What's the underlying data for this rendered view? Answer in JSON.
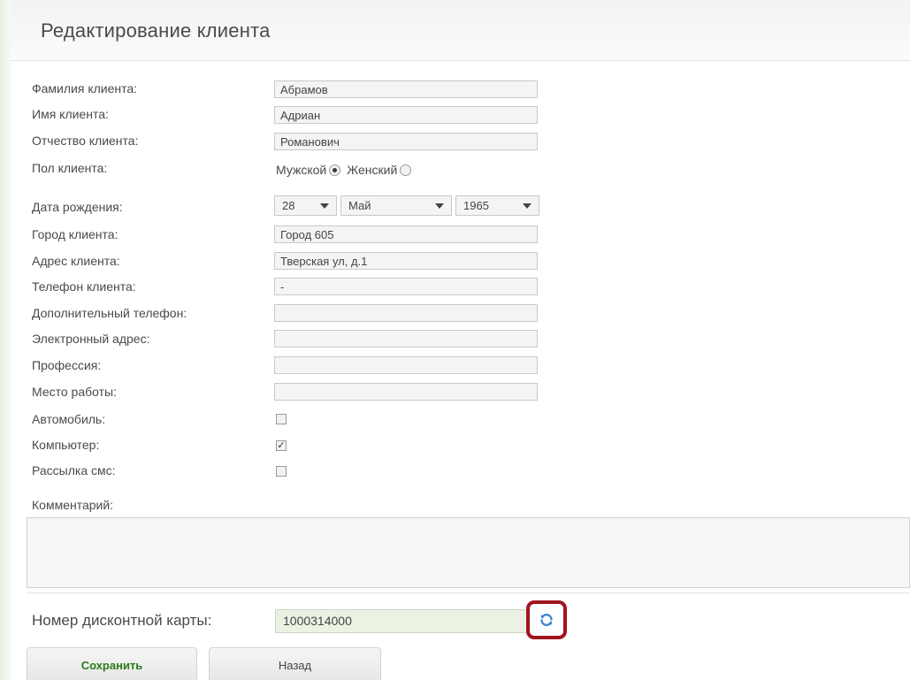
{
  "page_title": "Редактирование клиента",
  "fields": {
    "last_name": {
      "label": "Фамилия клиента:",
      "value": "Абрамов"
    },
    "first_name": {
      "label": "Имя клиента:",
      "value": "Адриан"
    },
    "patronymic": {
      "label": "Отчество клиента:",
      "value": "Романович"
    },
    "gender": {
      "label": "Пол клиента:",
      "male": "Мужской",
      "female": "Женский",
      "selected": "Мужской"
    },
    "birth_date": {
      "label": "Дата рождения:",
      "day": "28",
      "month": "Май",
      "year": "1965"
    },
    "city": {
      "label": "Город клиента:",
      "value": "Город 605"
    },
    "address": {
      "label": "Адрес клиента:",
      "value": "Тверская ул, д.1"
    },
    "phone": {
      "label": "Телефон клиента:",
      "value": "-"
    },
    "extra_phone": {
      "label": "Дополнительный телефон:",
      "value": ""
    },
    "email": {
      "label": "Электронный адрес:",
      "value": ""
    },
    "profession": {
      "label": "Профессия:",
      "value": ""
    },
    "workplace": {
      "label": "Место работы:",
      "value": ""
    },
    "car": {
      "label": "Автомобиль:",
      "checked": false
    },
    "computer": {
      "label": "Компьютер:",
      "checked": true
    },
    "sms": {
      "label": "Рассылка смс:",
      "checked": false
    },
    "comment": {
      "label": "Комментарий:",
      "value": ""
    }
  },
  "discount_card": {
    "label": "Номер дисконтной карты:",
    "value": "1000314000",
    "refresh_icon": "refresh-icon"
  },
  "buttons": {
    "save": "Сохранить",
    "back": "Назад"
  },
  "colors": {
    "highlight": "#a01520",
    "save_text": "#2c7a1c",
    "discount_bg": "#ebf2e3",
    "refresh_icon": "#3b86d4"
  }
}
